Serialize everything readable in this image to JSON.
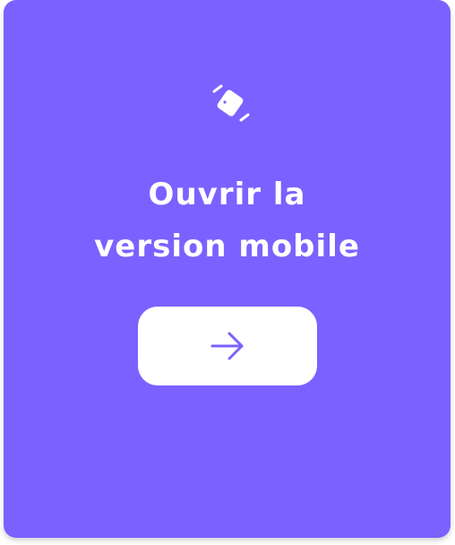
{
  "card": {
    "title_line1": "Ouvrir la",
    "title_line2": "version mobile",
    "icon": "screen-rotation-icon",
    "button": {
      "icon": "arrow-right-icon"
    }
  },
  "colors": {
    "card_background": "#7b61ff",
    "button_background": "#ffffff",
    "arrow": "#7b61ff",
    "text": "#ffffff"
  }
}
